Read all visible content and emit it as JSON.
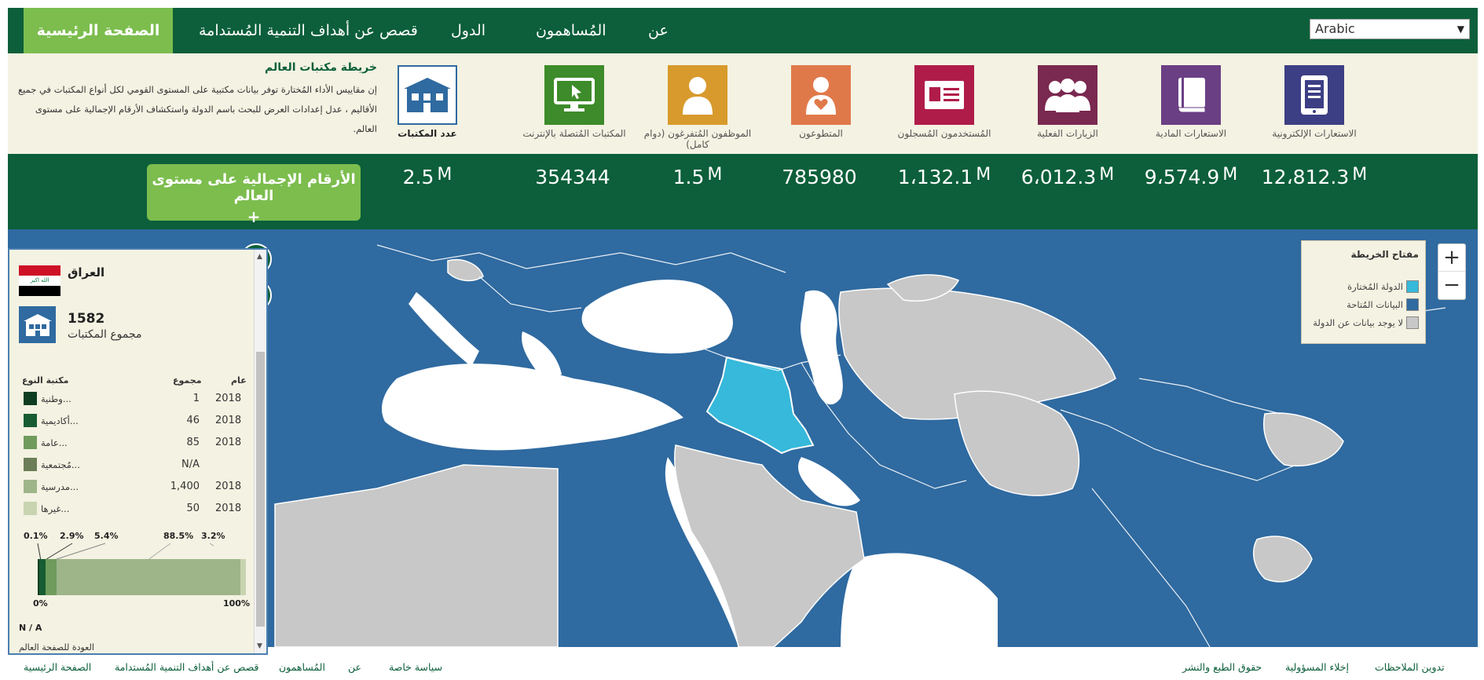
{
  "nav": {
    "home": "الصفحة الرئيسية",
    "stories": "قصص عن أهداف التنمية المُستدامة",
    "countries": "الدول",
    "contributors": "المُساهمون",
    "about": "عن",
    "language": "Arabic",
    "caret": "▼"
  },
  "intro": {
    "title": "خريطة مكتبات العالم",
    "body": "إن مقاييس الأداء المُختارة توفر بيانات مكتبية على المستوى القومي لكل أنواع المكتبات في جميع الأقاليم ، عدل إعدادات العرض للبحث باسم الدولة واستكشاف الأرقام الإجمالية على مستوى العالم."
  },
  "metrics": [
    {
      "label": "عدد المكتبات",
      "icon": "library-icon",
      "color": "#2f6aa0",
      "total": "2.5",
      "unit": "M",
      "selected": true
    },
    {
      "label": "المكتبات المُتصلة بالإنترنت",
      "icon": "computer-icon",
      "color": "#3d8b2a",
      "total": "354344",
      "unit": ""
    },
    {
      "label": "الموظفون المُتفرغون (دوام كامل)",
      "icon": "person-icon",
      "color": "#d89a2d",
      "total": "1.5",
      "unit": "M"
    },
    {
      "label": "المتطوعون",
      "icon": "volunteer-icon",
      "color": "#e0794a",
      "total": "785980",
      "unit": ""
    },
    {
      "label": "المُستخدمون المُسجلون",
      "icon": "id-card-icon",
      "color": "#b01c4a",
      "total": "1،132.1",
      "unit": "M"
    },
    {
      "label": "الزيارات الفعلية",
      "icon": "group-icon",
      "color": "#7a2950",
      "total": "6،012.3",
      "unit": "M"
    },
    {
      "label": "الاستعارات المادية",
      "icon": "book-icon",
      "color": "#6a3f84",
      "total": "9،574.9",
      "unit": "M"
    },
    {
      "label": "الاستعارات الإلكترونية",
      "icon": "tablet-icon",
      "color": "#3d3f84",
      "total": "12،812.3",
      "unit": "M"
    }
  ],
  "totals": {
    "button": "الأرقام الإجمالية على مستوى العالم",
    "plus": "+"
  },
  "map": {
    "help": "?",
    "legend": {
      "title": "مفتاح الخريطة",
      "items": [
        {
          "label": "الدولة المُختارة",
          "color": "#36b9da"
        },
        {
          "label": "البيانات المُتاحة",
          "color": "#2f6aa0"
        },
        {
          "label": "لا يوجد بيانات عن الدولة",
          "color": "#c8c8c8"
        }
      ]
    },
    "zoom_in": "+",
    "zoom_out": "−"
  },
  "panel": {
    "country": "العراق",
    "flag_text": "الله اكبر",
    "count": "1582",
    "caption": "مجموع المكتبات",
    "headers": {
      "type": "مكتبة النوع",
      "total": "مجموع",
      "year": "عام"
    },
    "rows": [
      {
        "type": "وطنية...",
        "total": "1",
        "year": "2018",
        "color": "#0e3d22"
      },
      {
        "type": "أكاديمية...",
        "total": "46",
        "year": "2018",
        "color": "#175c32"
      },
      {
        "type": "عامة...",
        "total": "85",
        "year": "2018",
        "color": "#6f9c5c"
      },
      {
        "type": "مُجتمعية...",
        "total": "N/A",
        "year": "",
        "color": "#6b7e58"
      },
      {
        "type": "مدرسية...",
        "total": "1,400",
        "year": "2018",
        "color": "#9eb58a"
      },
      {
        "type": "غيرها...",
        "total": "50",
        "year": "2018",
        "color": "#c8d4b0"
      }
    ],
    "percentages": [
      "0.1%",
      "2.9%",
      "5.4%",
      "88.5%",
      "3.2%"
    ],
    "axis_min": "0%",
    "axis_max": "100%",
    "na_note": "N / A",
    "footer": "العودة للصفحة العالم"
  },
  "footer": {
    "feedback": "تدوين الملاحظات",
    "disclaimer": "إخلاء المسؤولية",
    "copyright": "حقوق الطبع والنشر",
    "privacy": "سياسة خاصة",
    "about": "عن",
    "contributors": "المُساهمون",
    "stories": "قصص عن أهداف التنمية المُستدامة",
    "home": "الصفحة الرئيسية"
  }
}
